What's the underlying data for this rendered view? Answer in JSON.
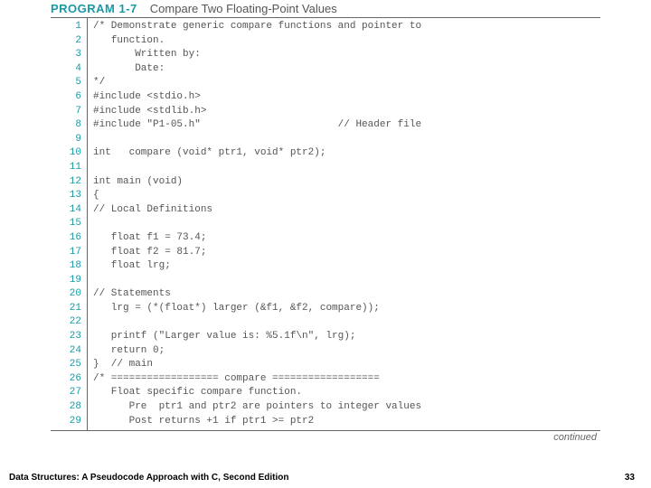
{
  "header": {
    "program": "PROGRAM 1-7",
    "title": "Compare Two Floating-Point Values"
  },
  "lines": [
    {
      "n": "1",
      "c": "/* Demonstrate generic compare functions and pointer to"
    },
    {
      "n": "2",
      "c": "   function."
    },
    {
      "n": "3",
      "c": "       Written by:"
    },
    {
      "n": "4",
      "c": "       Date:"
    },
    {
      "n": "5",
      "c": "*/"
    },
    {
      "n": "6",
      "c": "#include <stdio.h>"
    },
    {
      "n": "7",
      "c": "#include <stdlib.h>"
    },
    {
      "n": "8",
      "c": "#include \"P1-05.h\"                       // Header file"
    },
    {
      "n": "9",
      "c": ""
    },
    {
      "n": "10",
      "c": "int   compare (void* ptr1, void* ptr2);"
    },
    {
      "n": "11",
      "c": ""
    },
    {
      "n": "12",
      "c": "int main (void)"
    },
    {
      "n": "13",
      "c": "{"
    },
    {
      "n": "14",
      "c": "// Local Definitions"
    },
    {
      "n": "15",
      "c": ""
    },
    {
      "n": "16",
      "c": "   float f1 = 73.4;"
    },
    {
      "n": "17",
      "c": "   float f2 = 81.7;"
    },
    {
      "n": "18",
      "c": "   float lrg;"
    },
    {
      "n": "19",
      "c": ""
    },
    {
      "n": "20",
      "c": "// Statements"
    },
    {
      "n": "21",
      "c": "   lrg = (*(float*) larger (&f1, &f2, compare));"
    },
    {
      "n": "22",
      "c": ""
    },
    {
      "n": "23",
      "c": "   printf (\"Larger value is: %5.1f\\n\", lrg);"
    },
    {
      "n": "24",
      "c": "   return 0;"
    },
    {
      "n": "25",
      "c": "}  // main"
    },
    {
      "n": "26",
      "c": "/* ================== compare =================="
    },
    {
      "n": "27",
      "c": "   Float specific compare function."
    },
    {
      "n": "28",
      "c": "      Pre  ptr1 and ptr2 are pointers to integer values"
    },
    {
      "n": "29",
      "c": "      Post returns +1 if ptr1 >= ptr2"
    }
  ],
  "continued": "continued",
  "footer": {
    "book": "Data Structures: A Pseudocode Approach with C, Second Edition",
    "page": "33"
  }
}
